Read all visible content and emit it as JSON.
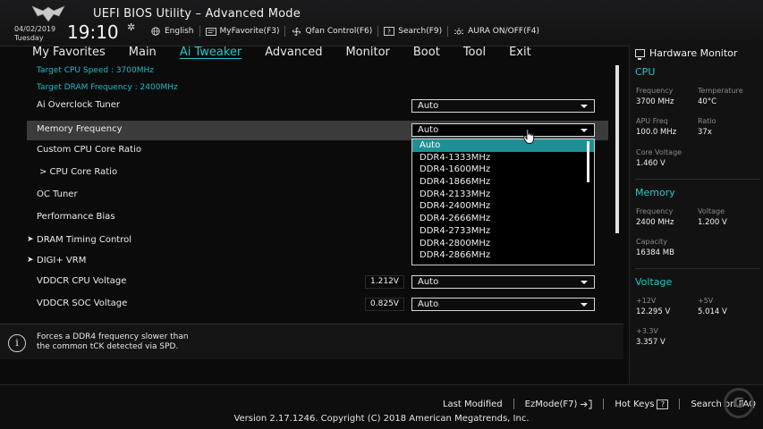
{
  "header": {
    "title": "UEFI BIOS Utility – Advanced Mode",
    "date": "04/02/2019",
    "weekday": "Tuesday",
    "time": "19:10",
    "tools": [
      {
        "label": "English",
        "icon": "globe-icon"
      },
      {
        "label": "MyFavorite(F3)",
        "icon": "favorite-icon"
      },
      {
        "label": "Qfan Control(F6)",
        "icon": "fan-icon"
      },
      {
        "label": "Search(F9)",
        "icon": "search-icon"
      },
      {
        "label": "AURA ON/OFF(F4)",
        "icon": "aura-icon"
      }
    ]
  },
  "tabs": [
    "My Favorites",
    "Main",
    "Ai Tweaker",
    "Advanced",
    "Monitor",
    "Boot",
    "Tool",
    "Exit"
  ],
  "active_tab": "Ai Tweaker",
  "main": {
    "target_cpu": "Target CPU Speed : 3700MHz",
    "target_dram": "Target DRAM Frequency : 2400MHz",
    "rows": {
      "ai_overclock": {
        "label": "Ai Overclock Tuner",
        "value": "Auto"
      },
      "memory_frequency": {
        "label": "Memory Frequency",
        "value": "Auto"
      },
      "custom_cpu_ratio": {
        "label": "Custom CPU Core Ratio"
      },
      "cpu_core_ratio": {
        "label": "> CPU Core Ratio"
      },
      "oc_tuner": {
        "label": "OC Tuner"
      },
      "performance_bias": {
        "label": "Performance Bias"
      },
      "dram_timing": {
        "label": "DRAM Timing Control",
        "arrow": "➤"
      },
      "digi_vrm": {
        "label": "DIGI+ VRM",
        "arrow": "➤"
      },
      "vddcr_cpu": {
        "label": "VDDCR CPU Voltage",
        "reading": "1.212V",
        "value": "Auto"
      },
      "vddcr_soc": {
        "label": "VDDCR SOC Voltage",
        "reading": "0.825V",
        "value": "Auto"
      }
    },
    "dropdown_options": [
      "Auto",
      "DDR4-1333MHz",
      "DDR4-1600MHz",
      "DDR4-1866MHz",
      "DDR4-2133MHz",
      "DDR4-2400MHz",
      "DDR4-2666MHz",
      "DDR4-2733MHz",
      "DDR4-2800MHz",
      "DDR4-2866MHz"
    ],
    "dropdown_selected": "Auto"
  },
  "help": {
    "line1": "Forces a DDR4 frequency slower than",
    "line2": "the common tCK detected via SPD."
  },
  "hw": {
    "title": "Hardware Monitor",
    "cpu": {
      "section": "CPU",
      "freq_label": "Frequency",
      "freq": "3700 MHz",
      "temp_label": "Temperature",
      "temp": "40°C",
      "apu_label": "APU Freq",
      "apu": "100.0 MHz",
      "ratio_label": "Ratio",
      "ratio": "37x",
      "corev_label": "Core Voltage",
      "corev": "1.460 V"
    },
    "memory": {
      "section": "Memory",
      "freq_label": "Frequency",
      "freq": "2400 MHz",
      "volt_label": "Voltage",
      "volt": "1.200 V",
      "cap_label": "Capacity",
      "cap": "16384 MB"
    },
    "voltage": {
      "section": "Voltage",
      "v12_label": "+12V",
      "v12": "12.295 V",
      "v5_label": "+5V",
      "v5": "5.014 V",
      "v33_label": "+3.3V",
      "v33": "3.357 V"
    }
  },
  "footer": {
    "last_modified": "Last Modified",
    "ezmode": "EzMode(F7)",
    "hotkeys": "Hot Keys",
    "hotkeys_key": "?",
    "search_faq": "Search on FAQ",
    "copyright": "Version 2.17.1246. Copyright (C) 2018 American Megatrends, Inc."
  },
  "colors": {
    "accent": "#29c5c5",
    "selection": "#1f8f96",
    "highlight_row": "#3b3b3d"
  }
}
